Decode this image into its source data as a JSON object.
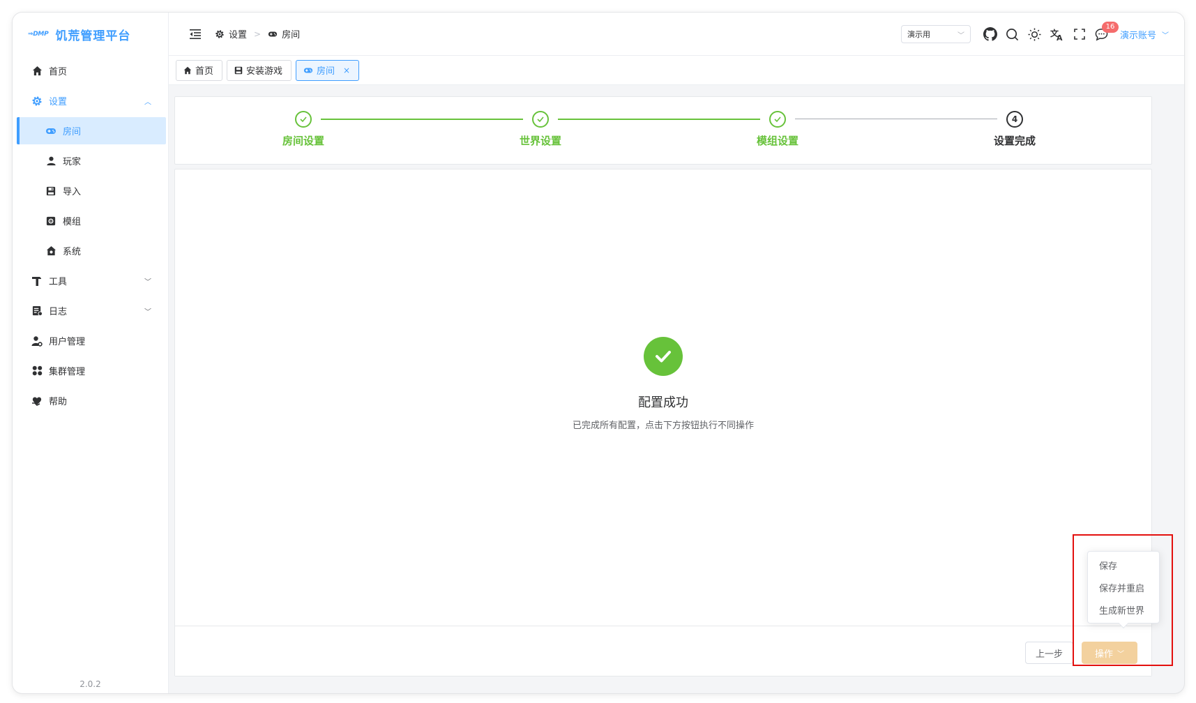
{
  "app": {
    "logo_mark": "⇒DMP",
    "title": "饥荒管理平台",
    "version": "2.0.2"
  },
  "sidebar": {
    "items": [
      {
        "label": "首页",
        "icon": "home-icon"
      },
      {
        "label": "设置",
        "icon": "gear-icon",
        "expanded": true
      },
      {
        "label": "房间",
        "icon": "gamepad-icon",
        "active": true
      },
      {
        "label": "玩家",
        "icon": "user-icon"
      },
      {
        "label": "导入",
        "icon": "save-icon"
      },
      {
        "label": "模组",
        "icon": "mod-icon"
      },
      {
        "label": "系统",
        "icon": "house-icon"
      },
      {
        "label": "工具",
        "icon": "hammer-icon"
      },
      {
        "label": "日志",
        "icon": "log-icon"
      },
      {
        "label": "用户管理",
        "icon": "user-gear-icon"
      },
      {
        "label": "集群管理",
        "icon": "grid-icon"
      },
      {
        "label": "帮助",
        "icon": "heart-hand-icon"
      }
    ]
  },
  "header": {
    "breadcrumb": [
      "设置",
      "房间"
    ],
    "select_value": "演示用",
    "badge_count": "16",
    "account": "演示账号"
  },
  "tabs": [
    {
      "label": "首页",
      "icon": "home-icon"
    },
    {
      "label": "安装游戏",
      "icon": "save-icon"
    },
    {
      "label": "房间",
      "icon": "gamepad-icon",
      "active": true,
      "close": "×"
    }
  ],
  "steps": [
    {
      "label": "房间设置",
      "status": "done"
    },
    {
      "label": "世界设置",
      "status": "done"
    },
    {
      "label": "模组设置",
      "status": "done"
    },
    {
      "label": "设置完成",
      "status": "current",
      "number": "4"
    }
  ],
  "result": {
    "title": "配置成功",
    "subtitle": "已完成所有配置，点击下方按钮执行不同操作"
  },
  "footer": {
    "prev_label": "上一步",
    "ops_label": "操作"
  },
  "dropdown": {
    "items": [
      "保存",
      "保存并重启",
      "生成新世界"
    ]
  },
  "colors": {
    "primary": "#409eff",
    "success": "#67c23a",
    "warning_light": "#f3d19e",
    "highlight": "#e3100e",
    "badge": "#f56c6c"
  }
}
